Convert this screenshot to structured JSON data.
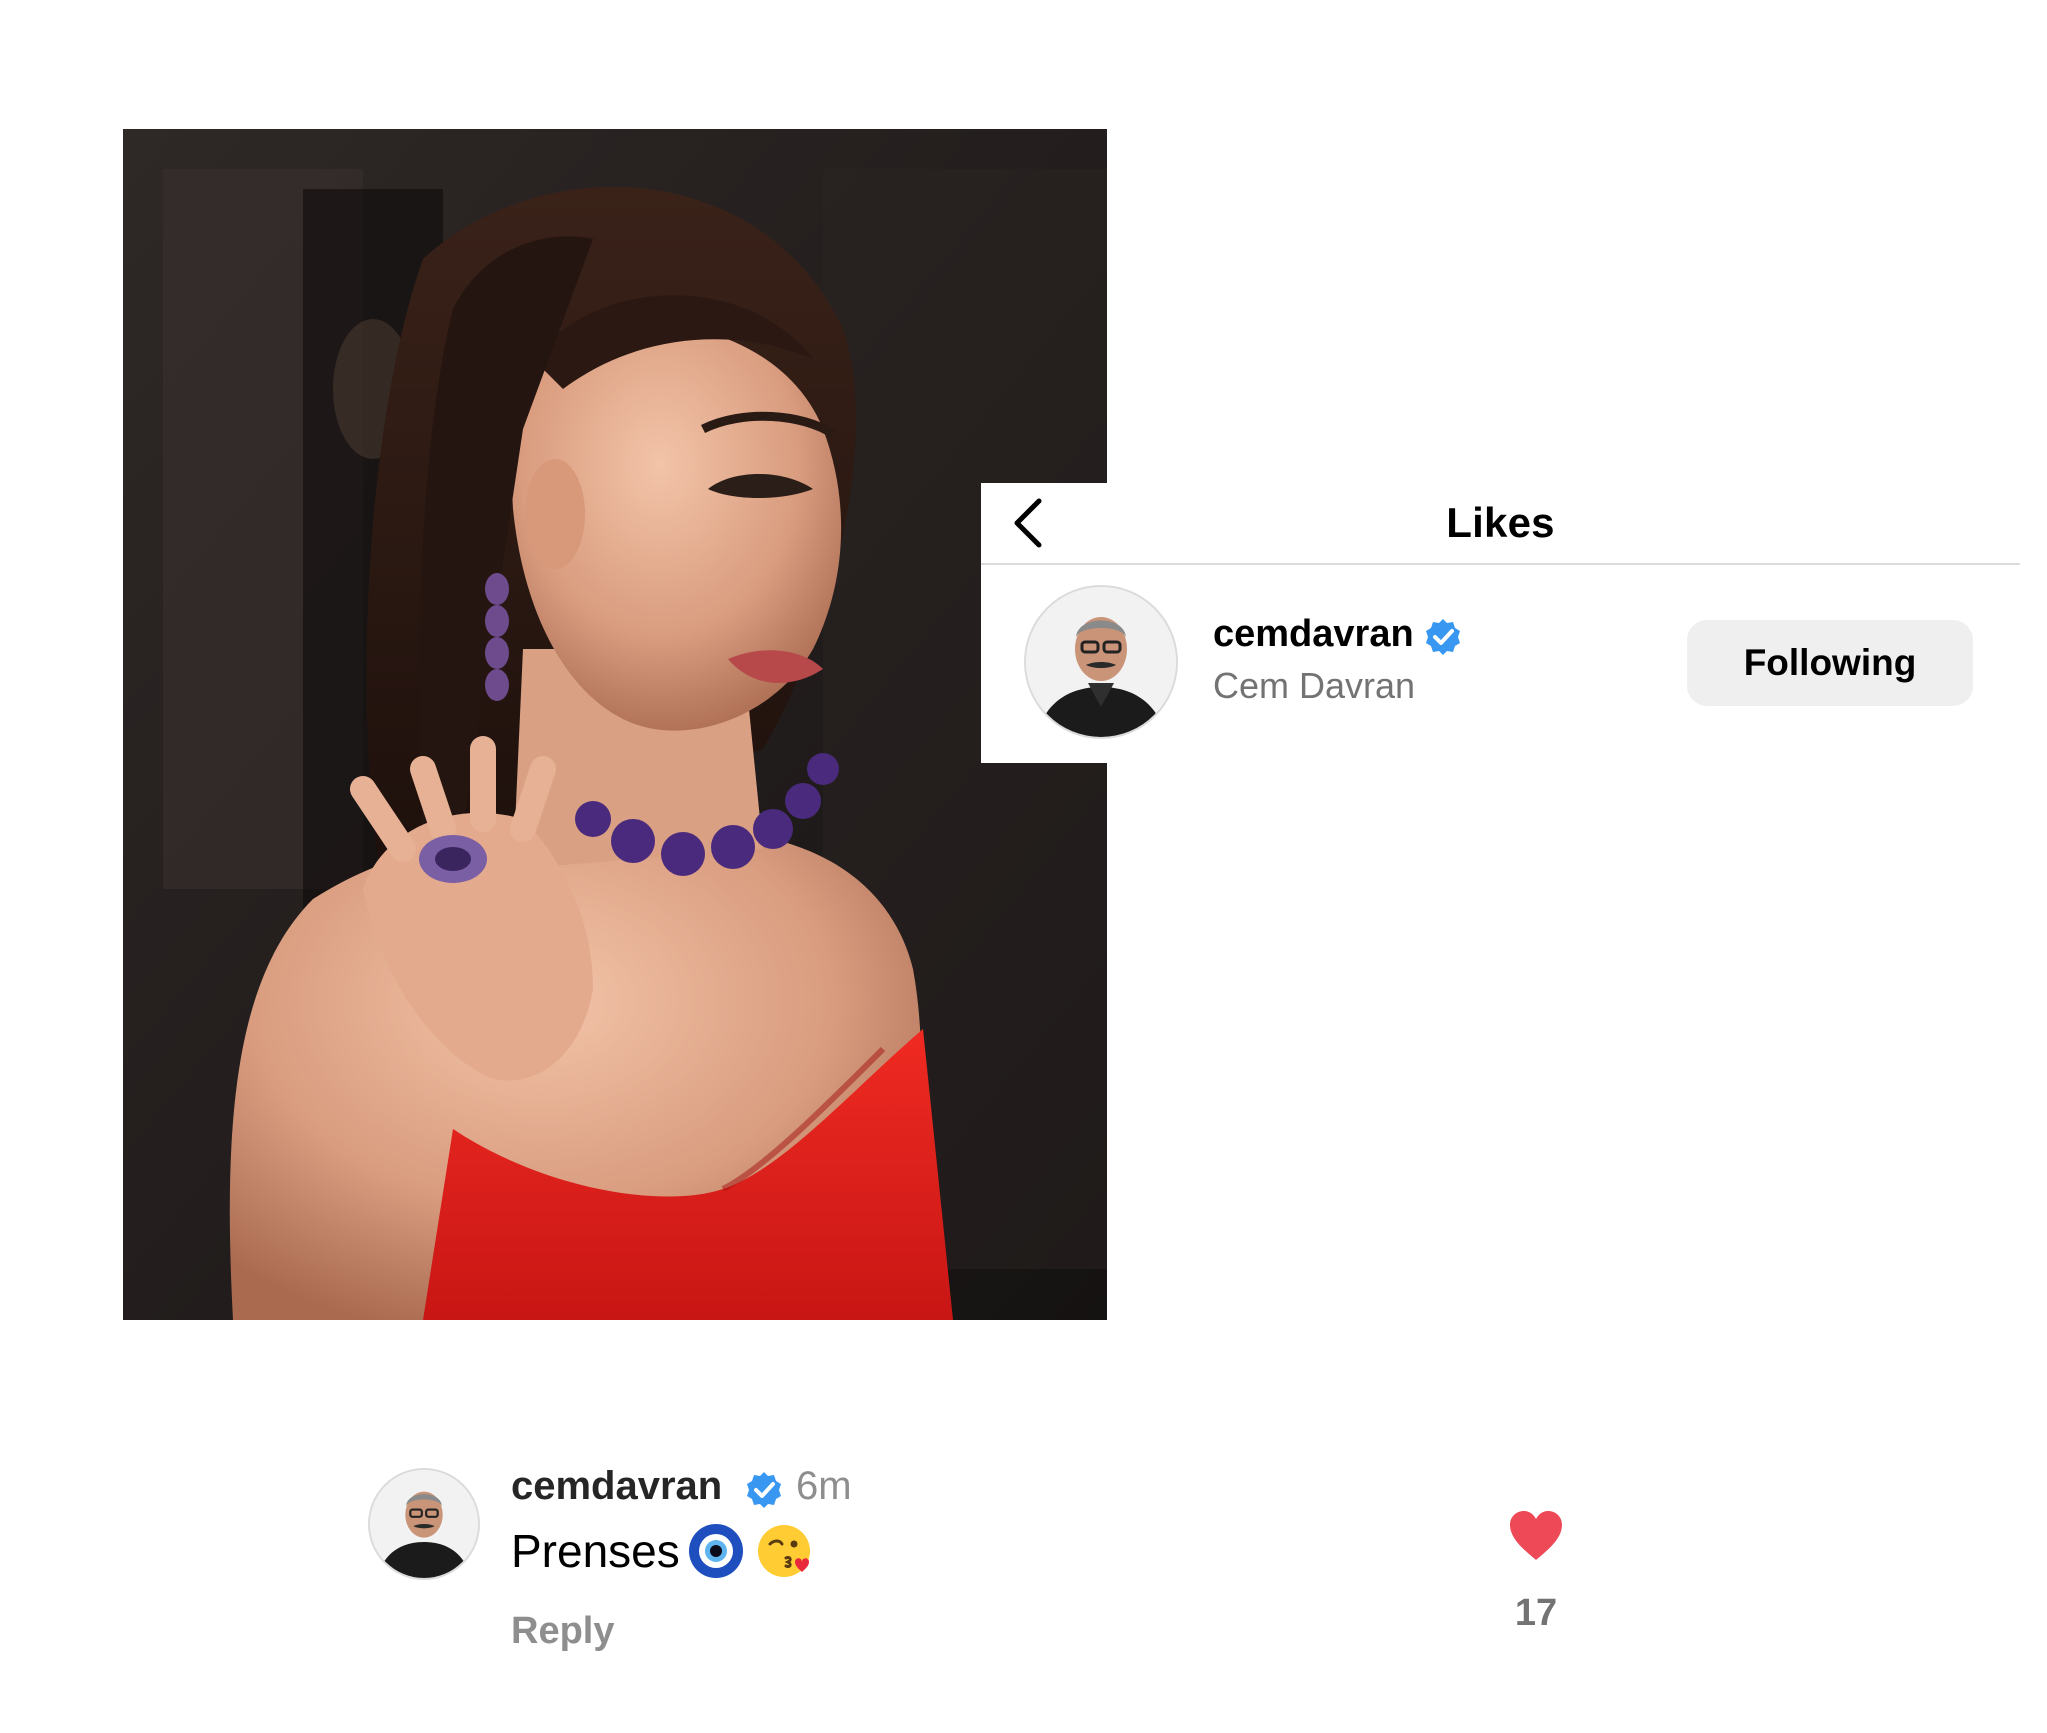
{
  "colors": {
    "verified_blue": "#3897f0",
    "heart_red": "#ed4956",
    "muted_text": "#737373",
    "divider": "#dbdbdb",
    "button_bg": "#efefef",
    "dress_red": "#e0201f"
  },
  "post": {
    "image_subject": "portrait-woman-red-dress-amethyst-jewelry"
  },
  "likes_panel": {
    "back_icon": "chevron-left-icon",
    "title": "Likes",
    "likers": [
      {
        "username": "cemdavran",
        "verified": true,
        "full_name": "Cem Davran",
        "follow_label": "Following"
      }
    ]
  },
  "comment": {
    "username": "cemdavran",
    "verified": true,
    "time": "6m",
    "text": "Prenses",
    "emojis": [
      "nazar-amulet-emoji",
      "face-blowing-kiss-emoji"
    ],
    "reply_label": "Reply",
    "heart_icon": "heart-filled-icon",
    "like_count": "17"
  }
}
